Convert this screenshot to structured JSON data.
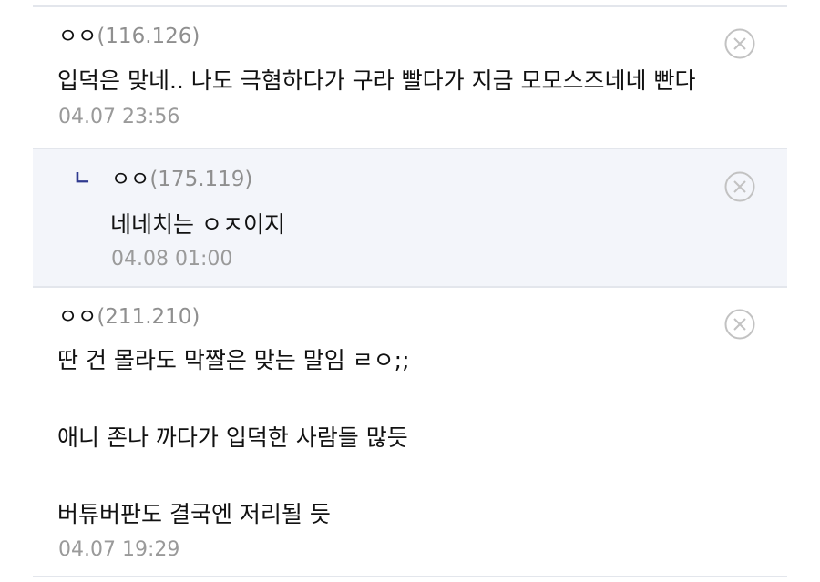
{
  "comments": [
    {
      "nick": "ㅇㅇ",
      "ip": "(116.126)",
      "body": "입덕은 맞네.. 나도 극혐하다가 구라 빨다가 지금 모모스즈네네 빤다",
      "time": "04.07 23:56",
      "delete_icon": "delete-circle-x-icon"
    },
    {
      "reply_mark": "ㄴ",
      "nick": "ㅇㅇ",
      "ip": "(175.119)",
      "body": "네네치는 ㅇㅈ이지",
      "time": "04.08 01:00",
      "delete_icon": "delete-circle-x-icon"
    },
    {
      "nick": "ㅇㅇ",
      "ip": "(211.210)",
      "body_lines": [
        "딴 건 몰라도 막짤은 맞는 말임 ㄹㅇ;;",
        "애니 존나 까다가 입덕한 사람들 많듯",
        "버튜버판도 결국엔 저리될 듯"
      ],
      "time": "04.07 19:29",
      "delete_icon": "delete-circle-x-icon"
    }
  ],
  "colors": {
    "reply_background": "#f3f5fa",
    "divider": "#e3e6ec",
    "reply_mark": "#2f3a8f",
    "muted_text": "#9a9a9a"
  }
}
